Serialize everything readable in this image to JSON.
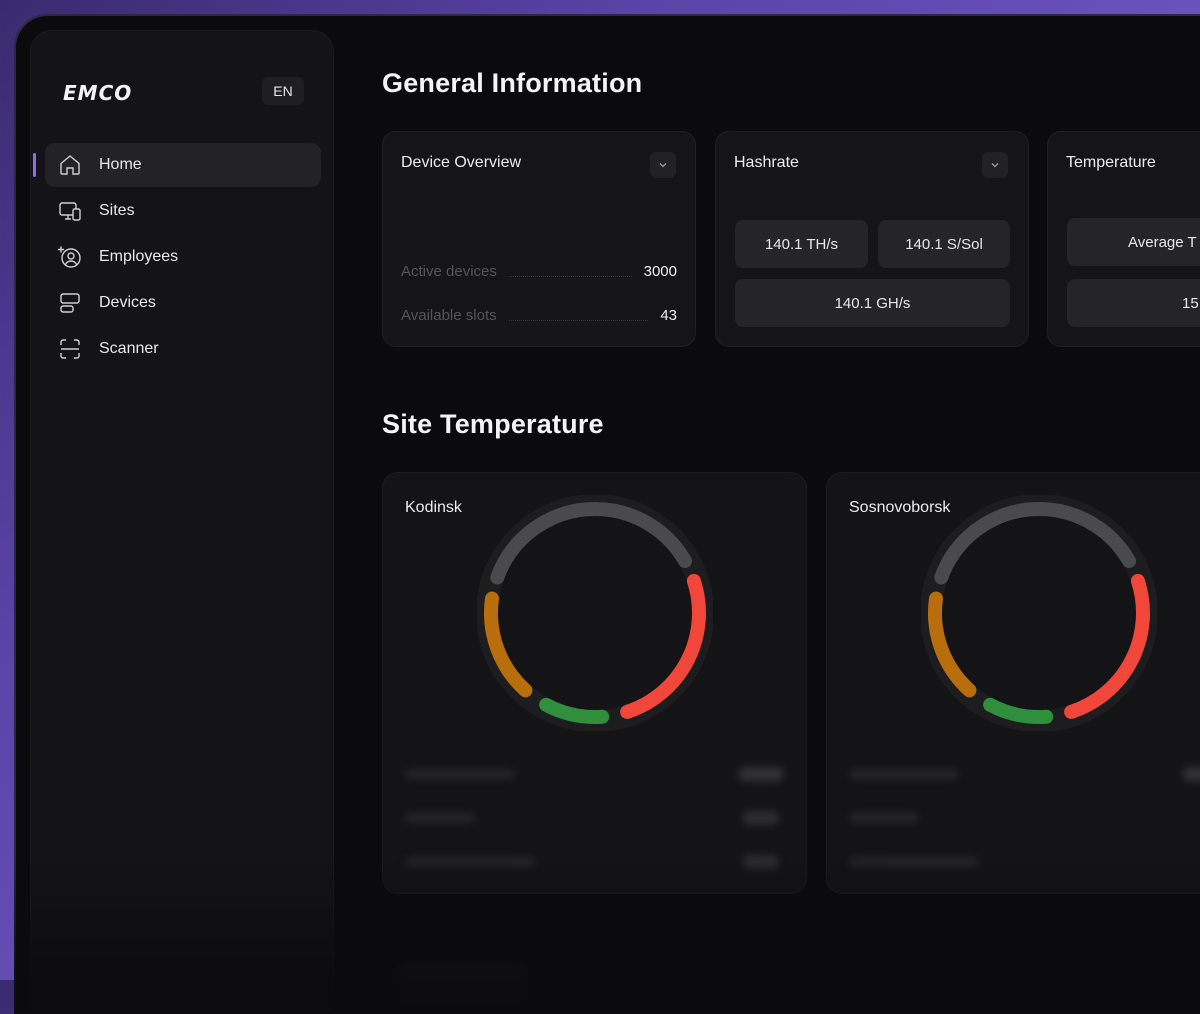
{
  "brand": {
    "logo": "EMCO",
    "language": "EN"
  },
  "sidebar": {
    "items": [
      {
        "label": "Home",
        "icon": "home-icon",
        "active": true
      },
      {
        "label": "Sites",
        "icon": "sites-icon",
        "active": false
      },
      {
        "label": "Employees",
        "icon": "employees-icon",
        "active": false
      },
      {
        "label": "Devices",
        "icon": "devices-icon",
        "active": false
      },
      {
        "label": "Scanner",
        "icon": "scanner-icon",
        "active": false
      }
    ]
  },
  "general": {
    "title": "General Information",
    "device_overview": {
      "title": "Device Overview",
      "rows": [
        {
          "label": "Active devices",
          "value": "3000"
        },
        {
          "label": "Available slots",
          "value": "43"
        }
      ]
    },
    "hashrate": {
      "title": "Hashrate",
      "values": [
        "140.1 TH/s",
        "140.1 S/Sol",
        "140.1 GH/s"
      ]
    },
    "temperature": {
      "title": "Temperature",
      "values": [
        "Average T",
        "15"
      ]
    }
  },
  "site_temperature": {
    "title": "Site Temperature",
    "sites": [
      {
        "name": "Kodinsk"
      },
      {
        "name": "Sosnovoborsk"
      }
    ]
  },
  "colors": {
    "accent": "#8a6cf0",
    "ring_gray": "#4a4a4e",
    "ring_red": "#f0473a",
    "ring_orange": "#b86e0c",
    "ring_green": "#2f8f3c"
  }
}
